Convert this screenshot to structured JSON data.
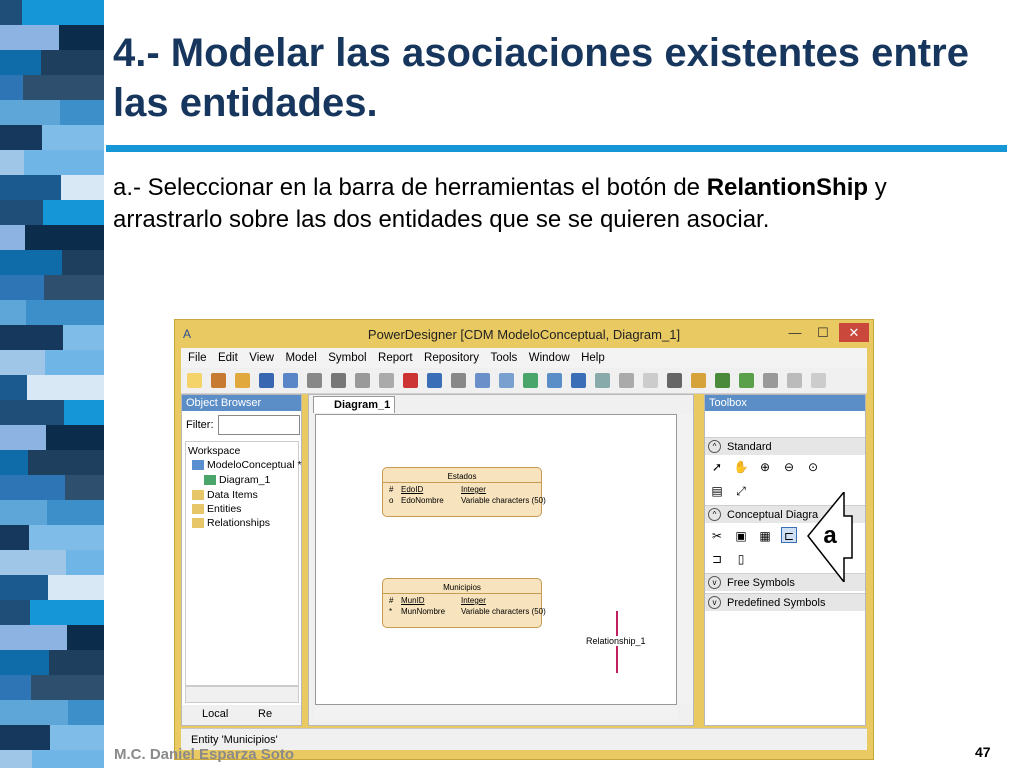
{
  "slide": {
    "title": "4.- Modelar las asociaciones existentes entre las entidades.",
    "body_prefix": "a.- Seleccionar en la barra de herramientas el botón de",
    "body_bold": "RelantionShip",
    "body_suffix": "y arrastrarlo sobre las dos entidades que se se quieren asociar.",
    "author": "M.C. Daniel Esparza Soto",
    "page_number": "47",
    "accent_color": "#1596d6",
    "title_color": "#17365d",
    "callout_label": "a"
  },
  "window": {
    "title": "PowerDesigner [CDM ModeloConceptual, Diagram_1]",
    "app_icon": "A",
    "minimize": "—",
    "maximize": "☐",
    "close": "✕",
    "frame_color": "#e9c961",
    "menu": [
      "File",
      "Edit",
      "View",
      "Model",
      "Symbol",
      "Report",
      "Repository",
      "Tools",
      "Window",
      "Help"
    ],
    "object_browser": {
      "title": "Object Browser",
      "filter_label": "Filter:",
      "filter_value": "",
      "tree": [
        "Workspace",
        "ModeloConceptual *",
        "Diagram_1",
        "Data Items",
        "Entities",
        "Relationships"
      ],
      "tab_local": "Local",
      "tab_re": "Re"
    },
    "diagram": {
      "tab": "Diagram_1",
      "entities": [
        {
          "name": "Estados",
          "attributes": [
            {
              "key": "#",
              "name": "EdoID",
              "type": "Integer"
            },
            {
              "key": "o",
              "name": "EdoNombre",
              "type": "Variable characters (50)"
            }
          ]
        },
        {
          "name": "Municipios",
          "attributes": [
            {
              "key": "#",
              "name": "MunID",
              "type": "Integer"
            },
            {
              "key": "*",
              "name": "MunNombre",
              "type": "Variable characters (50)"
            }
          ]
        }
      ],
      "relationship": "Relationship_1"
    },
    "toolbox": {
      "title": "Toolbox",
      "sections": [
        "Standard",
        "Conceptual Diagra",
        "Free Symbols",
        "Predefined Symbols"
      ]
    },
    "status_text": "Entity 'Municipios'"
  }
}
